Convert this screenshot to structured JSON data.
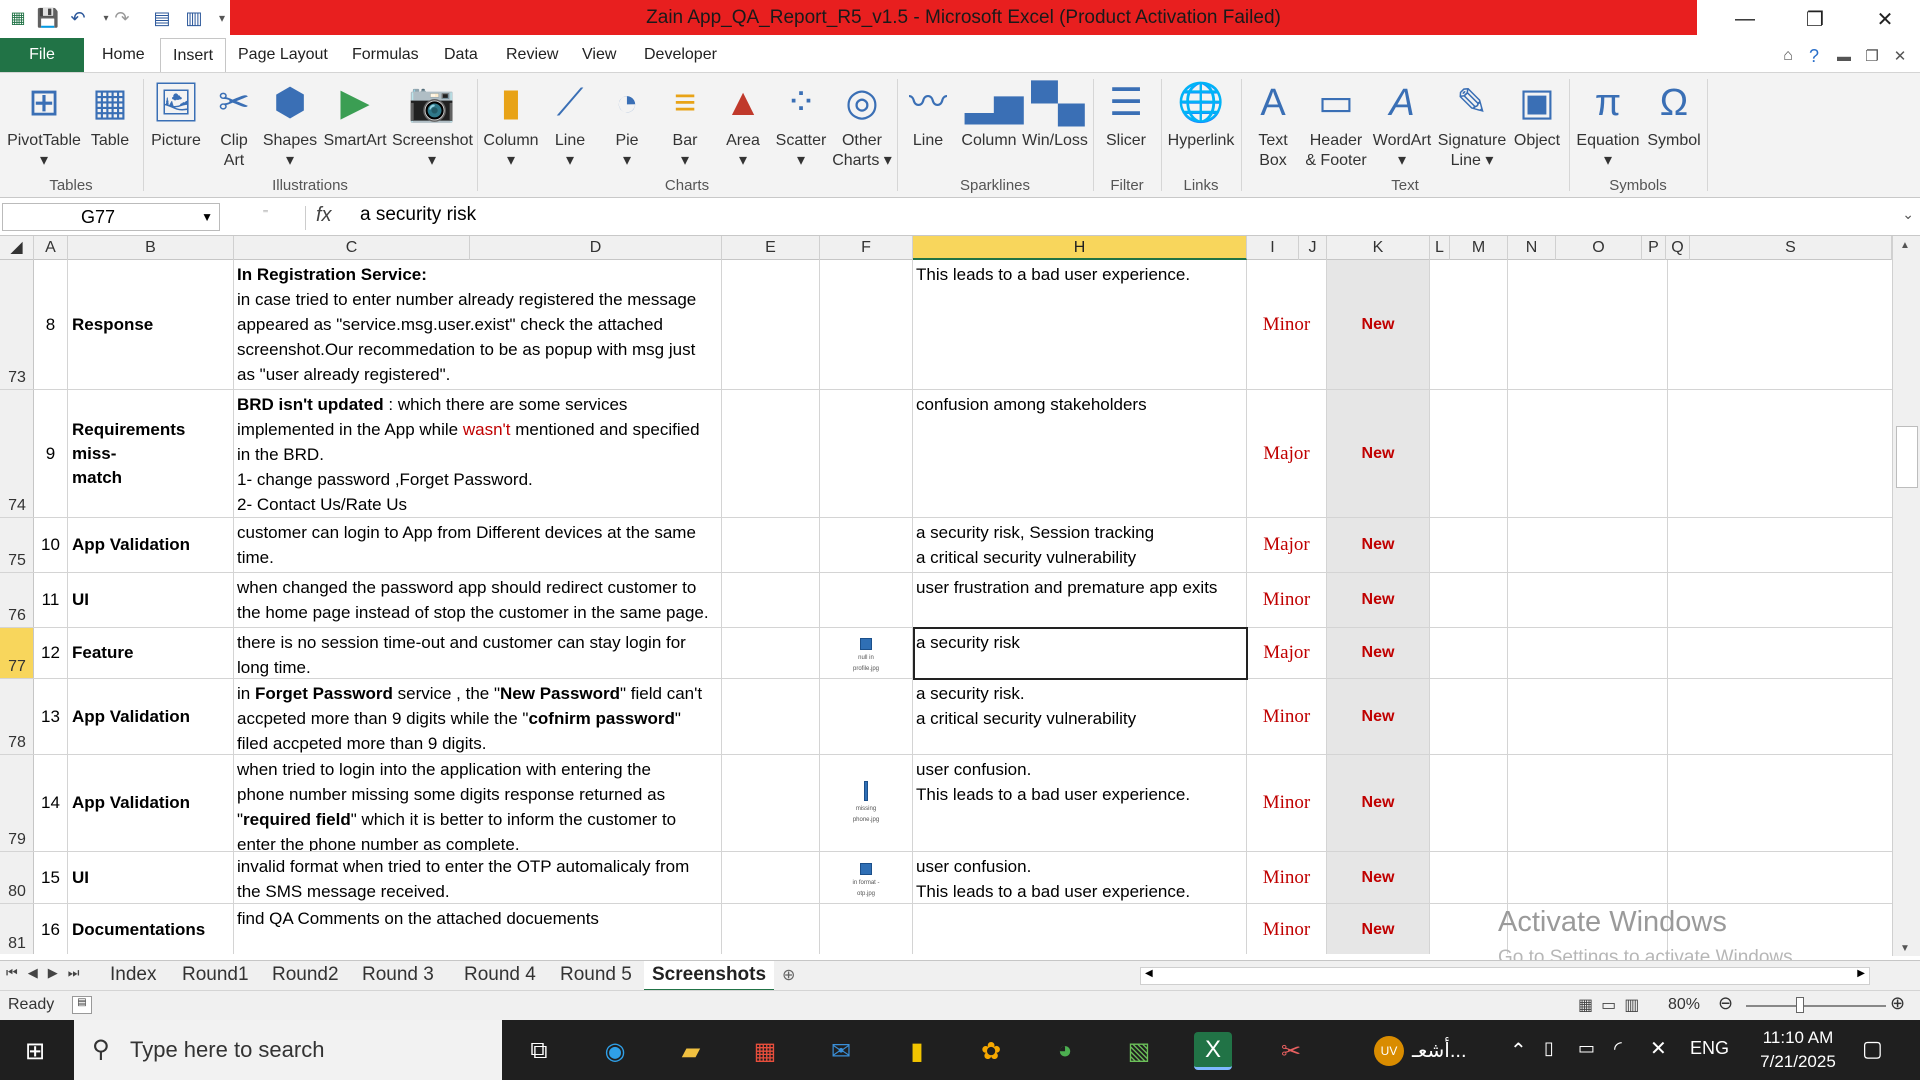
{
  "window": {
    "title": "Zain App_QA_Report_R5_v1.5 - Microsoft Excel (Product Activation Failed)"
  },
  "tabs": [
    "File",
    "Home",
    "Insert",
    "Page Layout",
    "Formulas",
    "Data",
    "Review",
    "View",
    "Developer"
  ],
  "ribbon": {
    "groups": {
      "tables": "Tables",
      "illustrations": "Illustrations",
      "charts": "Charts",
      "sparklines": "Sparklines",
      "filter": "Filter",
      "links": "Links",
      "text": "Text",
      "symbols": "Symbols"
    },
    "buttons": {
      "pivottable": "PivotTable",
      "table": "Table",
      "picture": "Picture",
      "clipart_1": "Clip",
      "clipart_2": "Art",
      "shapes": "Shapes",
      "smartart": "SmartArt",
      "screenshot": "Screenshot",
      "column": "Column",
      "line": "Line",
      "pie": "Pie",
      "bar": "Bar",
      "area": "Area",
      "scatter": "Scatter",
      "othercharts_1": "Other",
      "othercharts_2": "Charts",
      "spark_line": "Line",
      "spark_column": "Column",
      "spark_winloss": "Win/Loss",
      "slicer": "Slicer",
      "hyperlink": "Hyperlink",
      "textbox_1": "Text",
      "textbox_2": "Box",
      "header_1": "Header",
      "header_2": "& Footer",
      "wordart": "WordArt",
      "signature_1": "Signature",
      "signature_2": "Line",
      "object": "Object",
      "equation": "Equation",
      "symbol": "Symbol"
    }
  },
  "formula_bar": {
    "name_box": "G77",
    "fx": "fx",
    "value": "a security risk"
  },
  "columns": [
    "A",
    "B",
    "C",
    "D",
    "E",
    "F",
    "H",
    "I",
    "J",
    "K",
    "L",
    "M",
    "N",
    "O",
    "P",
    "Q",
    "S"
  ],
  "rows": [
    {
      "row": "73",
      "num": "8",
      "title": "Response",
      "desc": {
        "l1": "In Registration Service:",
        "l2": "in case tried to enter number already registered the message",
        "l3": "appeared as \"service.msg.user.exist\" check the attached",
        "l4": "screenshot.Our recommedation to be as popup with msg just",
        "l5": "as \"user already registered\"."
      },
      "impact": {
        "l1": "This leads to a bad user experience.",
        "l2": ""
      },
      "severity": "Minor",
      "status": "New"
    },
    {
      "row": "74",
      "num": "9",
      "title_1": "Requirements miss-",
      "title_2": "match",
      "desc": {
        "b1": "BRD isn't updated",
        "t1": " : which there are some services",
        "l2a": "implemented in the App while ",
        "l2red": "wasn't",
        "l2b": " mentioned and specified",
        "l3": "in the BRD.",
        "l4": "1- change password ,Forget Password.",
        "l5": "2- Contact Us/Rate Us"
      },
      "impact": {
        "l1": "confusion among stakeholders"
      },
      "severity": "Major",
      "status": "New"
    },
    {
      "row": "75",
      "num": "10",
      "title": "App Validation",
      "desc": {
        "l1": "customer can login to App from Different devices at the same",
        "l2": "time."
      },
      "impact": {
        "l1": " a security risk, Session tracking",
        "l2": "a critical security vulnerability"
      },
      "severity": "Major",
      "status": "New"
    },
    {
      "row": "76",
      "num": "11",
      "title": "UI",
      "desc": {
        "l1": "when changed the password app should redirect customer to",
        "l2": "the home page instead of stop the customer in the same page."
      },
      "impact": {
        "l1": "user frustration and premature app exits"
      },
      "severity": "Minor",
      "status": "New"
    },
    {
      "row": "77",
      "num": "12",
      "title": "Feature",
      "desc": {
        "l1": "there is no session time-out and customer can stay login for",
        "l2": "long time."
      },
      "attachment": "null in profile.jpg",
      "impact": {
        "l1": " a security risk"
      },
      "severity": "Major",
      "status": "New"
    },
    {
      "row": "78",
      "num": "13",
      "title": "App Validation",
      "desc": {
        "a": "in ",
        "b": "Forget Password",
        "c": " service , the \"",
        "d": "New Password",
        "e": "\" field can't",
        "l2a": "accpeted more than 9 digits while the \"",
        "l2b": "cofnirm password",
        "l2c": "\"",
        "l3": "filed accpeted more than 9 digits."
      },
      "impact": {
        "l1": " a security risk.",
        "l2": "a critical security vulnerability"
      },
      "severity": "Minor",
      "status": "New"
    },
    {
      "row": "79",
      "num": "14",
      "title": "App Validation",
      "desc": {
        "l1": "when tried to login into the application with entering the",
        "l2": "phone number missing some digits response returned as",
        "l3a": "\"",
        "l3b": "required field",
        "l3c": "\" which it is better to inform the customer to",
        "l4": "enter the phone number as complete."
      },
      "attachment": "missing phone.jpg",
      "impact": {
        "l1": "user confusion.",
        "l2": "This leads to a bad user experience."
      },
      "severity": "Minor",
      "status": "New"
    },
    {
      "row": "80",
      "num": "15",
      "title": "UI",
      "desc": {
        "l1": "invalid format when tried to enter the OTP automalicaly from",
        "l2": "the SMS message received."
      },
      "attachment": "in format - otp.jpg",
      "impact": {
        "l1": "user confusion.",
        "l2": "This leads to a bad user experience."
      },
      "severity": "Minor",
      "status": "New"
    },
    {
      "row": "81",
      "num": "16",
      "title": "Documentations",
      "desc": {
        "l1": "find QA Comments on the attached docuements"
      },
      "impact": {
        "l1": ""
      },
      "severity": "Minor",
      "status": "New"
    }
  ],
  "sheets": [
    "Index",
    "Round1",
    "Round2",
    "Round 3",
    "Round 4",
    "Round 5",
    "Screenshots"
  ],
  "status": {
    "ready": "Ready",
    "zoom": "80%"
  },
  "watermark": {
    "l1": "Activate Windows",
    "l2": "Go to Settings to activate Windows."
  },
  "taskbar": {
    "search": "Type here to search",
    "lang": "ENG",
    "time": "11:10 AM",
    "date": "7/21/2025",
    "avatar": "UV",
    "arabic": "أشعـ..."
  },
  "colors": {
    "excel_green": "#217346",
    "title_red": "#e81f1f",
    "severity_red": "#c00000",
    "selected_header": "#f8d65c"
  }
}
